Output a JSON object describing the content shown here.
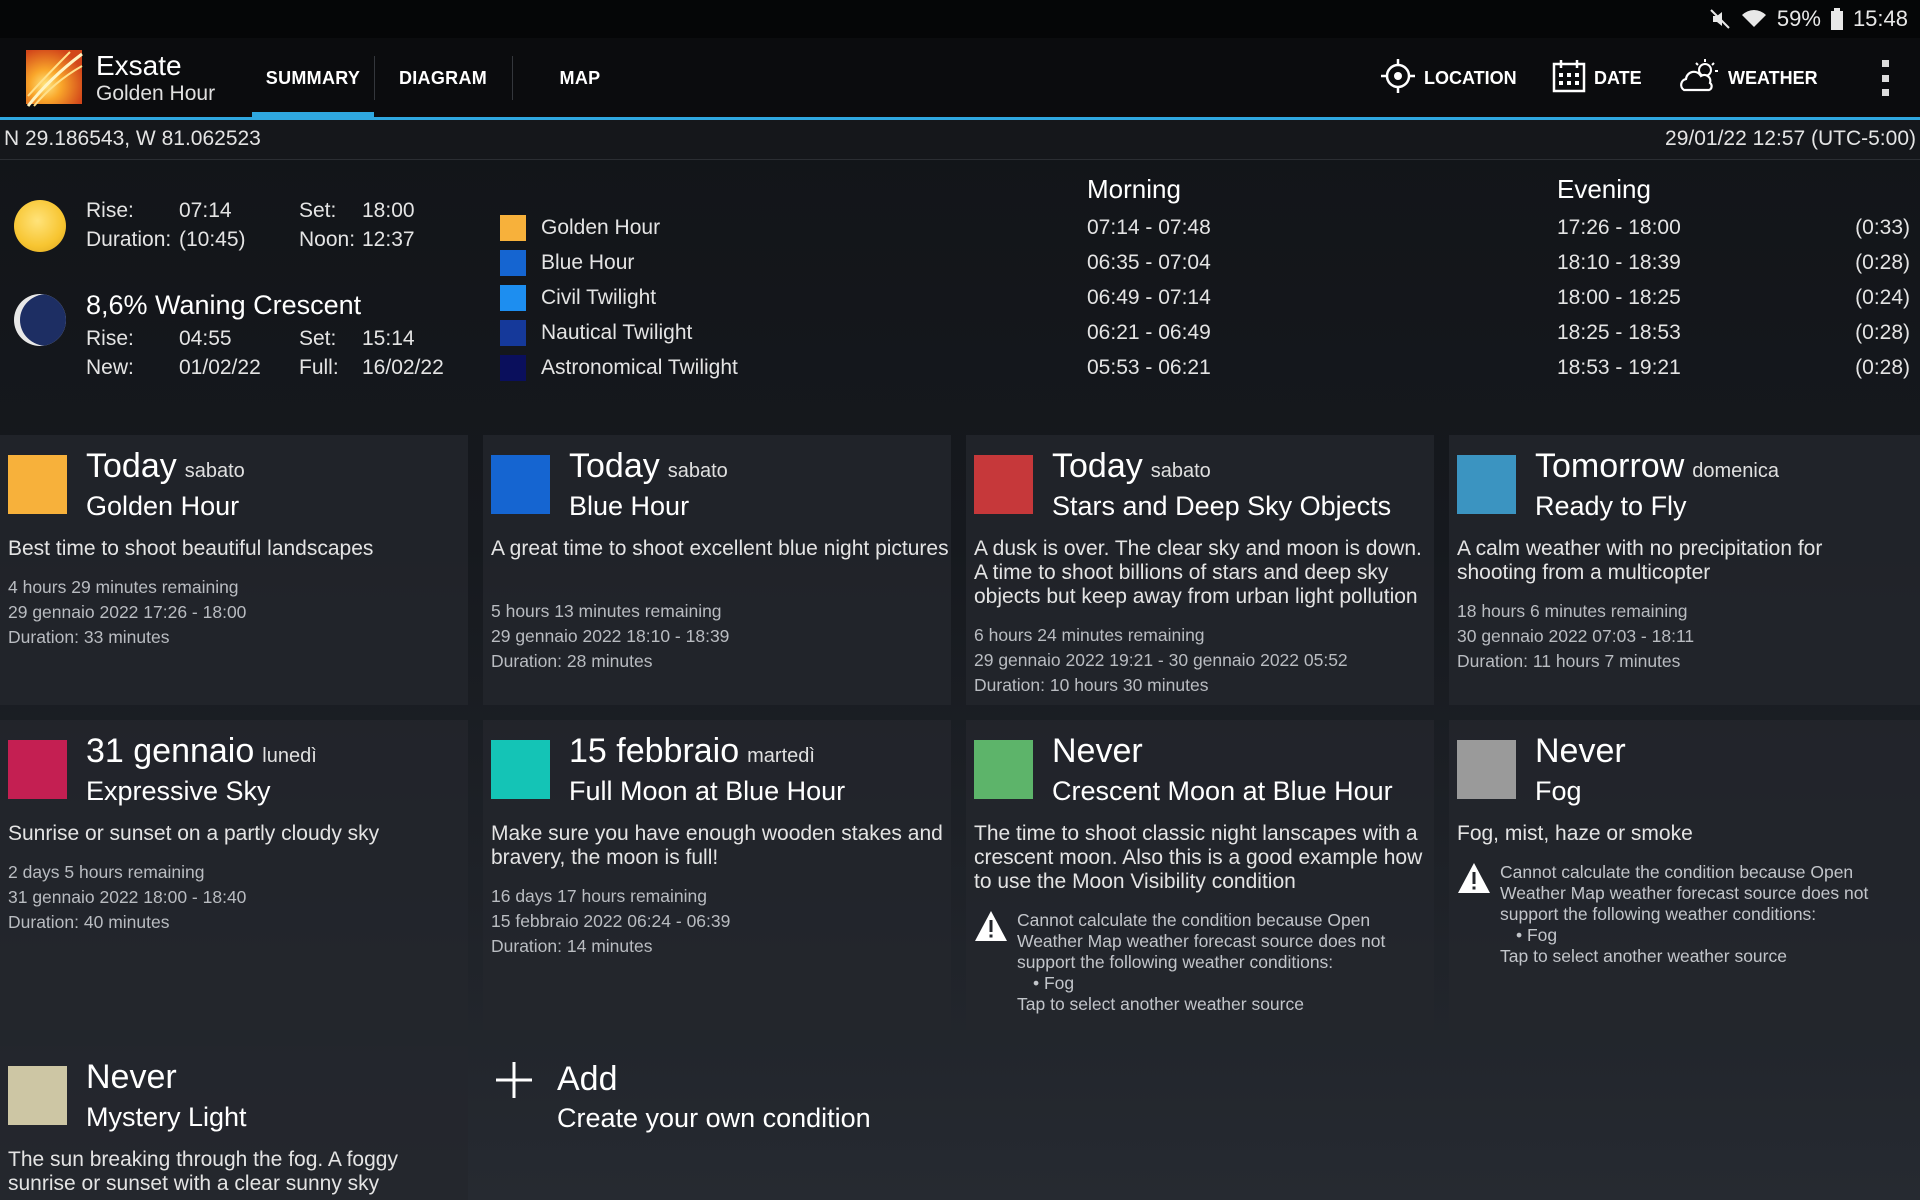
{
  "status": {
    "battery": "59%",
    "time": "15:48"
  },
  "app": {
    "title": "Exsate",
    "subtitle": "Golden Hour"
  },
  "tabs": [
    {
      "label": "SUMMARY",
      "active": true
    },
    {
      "label": "DIAGRAM",
      "active": false
    },
    {
      "label": "MAP",
      "active": false
    }
  ],
  "actions": {
    "location": "LOCATION",
    "date": "DATE",
    "weather": "WEATHER"
  },
  "coords": "N 29.186543, W 81.062523",
  "datetime": "29/01/22 12:57 (UTC-5:00)",
  "sun": {
    "rise_label": "Rise:",
    "rise": "07:14",
    "set_label": "Set:",
    "set": "18:00",
    "duration_label": "Duration:",
    "duration": "(10:45)",
    "noon_label": "Noon:",
    "noon": "12:37"
  },
  "moon": {
    "phase": "8,6% Waning Crescent",
    "rise_label": "Rise:",
    "rise": "04:55",
    "set_label": "Set:",
    "set": "15:14",
    "new_label": "New:",
    "new": "01/02/22",
    "full_label": "Full:",
    "full": "16/02/22"
  },
  "periods_header": {
    "morning": "Morning",
    "evening": "Evening"
  },
  "periods": [
    {
      "name": "Golden Hour",
      "color": "#f7b13b",
      "morning": "07:14 - 07:48",
      "evening": "17:26 - 18:00",
      "duration": "(0:33)"
    },
    {
      "name": "Blue Hour",
      "color": "#1565d1",
      "morning": "06:35 - 07:04",
      "evening": "18:10 - 18:39",
      "duration": "(0:28)"
    },
    {
      "name": "Civil Twilight",
      "color": "#1d8ef0",
      "morning": "06:49 - 07:14",
      "evening": "18:00 - 18:25",
      "duration": "(0:24)"
    },
    {
      "name": "Nautical Twilight",
      "color": "#15399a",
      "morning": "06:21 - 06:49",
      "evening": "18:25 - 18:53",
      "duration": "(0:28)"
    },
    {
      "name": "Astronomical Twilight",
      "color": "#0a0f5c",
      "morning": "05:53 - 06:21",
      "evening": "18:53 - 19:21",
      "duration": "(0:28)"
    }
  ],
  "cards": [
    {
      "when": "Today",
      "dow": "sabato",
      "name": "Golden Hour",
      "color": "#f7b13b",
      "desc": "Best time to shoot beautiful landscapes",
      "remaining": "4 hours 29 minutes remaining",
      "range": "29 gennaio 2022 17:26 - 18:00",
      "duration": "Duration: 33 minutes"
    },
    {
      "when": "Today",
      "dow": "sabato",
      "name": "Blue Hour",
      "color": "#1565d1",
      "desc": "A great time to shoot excellent blue night pictures",
      "remaining": "5 hours 13 minutes remaining",
      "range": "29 gennaio 2022 18:10 - 18:39",
      "duration": "Duration: 28 minutes"
    },
    {
      "when": "Today",
      "dow": "sabato",
      "name": "Stars and Deep Sky Objects",
      "color": "#c6383a",
      "desc": "A dusk is over. The clear sky and moon is down. A time to shoot billions of stars and deep sky objects but keep away from urban light pollution",
      "remaining": "6 hours 24 minutes remaining",
      "range": "29 gennaio 2022 19:21 - 30 gennaio 2022 05:52",
      "duration": "Duration: 10 hours 30 minutes"
    },
    {
      "when": "Tomorrow",
      "dow": "domenica",
      "name": "Ready to Fly",
      "color": "#3b94c1",
      "desc": "A calm weather with no precipitation for shooting from a multicopter",
      "remaining": "18 hours 6 minutes remaining",
      "range": "30 gennaio 2022 07:03 - 18:11",
      "duration": "Duration: 11 hours 7 minutes"
    },
    {
      "when": "31 gennaio",
      "dow": "lunedì",
      "name": "Expressive Sky",
      "color": "#c41f52",
      "desc": "Sunrise or sunset on a partly cloudy sky",
      "remaining": "2 days 5 hours remaining",
      "range": "31 gennaio 2022 18:00 - 18:40",
      "duration": "Duration: 40 minutes"
    },
    {
      "when": "15 febbraio",
      "dow": "martedì",
      "name": "Full Moon at Blue Hour",
      "color": "#14c4b6",
      "desc": "Make sure you have enough wooden stakes and bravery, the moon is full!",
      "remaining": "16 days 17 hours remaining",
      "range": "15 febbraio 2022 06:24 - 06:39",
      "duration": "Duration: 14 minutes"
    },
    {
      "when": "Never",
      "dow": "",
      "name": "Crescent Moon at Blue Hour",
      "color": "#5db46a",
      "desc": "The time to shoot classic night lanscapes with a crescent moon. Also this is a good example how to use the Moon Visibility condition",
      "warning": "Cannot calculate the condition because Open Weather Map weather forecast source does not support the following weather conditions:",
      "bullet": "• Fog",
      "tap": "Tap to select another weather source"
    },
    {
      "when": "Never",
      "dow": "",
      "name": "Fog",
      "color": "#9a9a9a",
      "desc": "Fog, mist, haze or smoke",
      "warning": "Cannot calculate the condition because Open Weather Map weather forecast source does not support the following weather conditions:",
      "bullet": "• Fog",
      "tap": "Tap to select another weather source"
    },
    {
      "when": "Never",
      "dow": "",
      "name": "Mystery Light",
      "color": "#cdc6a4",
      "desc": "The sun breaking through the fog. A foggy sunrise or sunset with a clear sunny sky"
    }
  ],
  "add": {
    "title": "Add",
    "subtitle": "Create your own condition"
  }
}
